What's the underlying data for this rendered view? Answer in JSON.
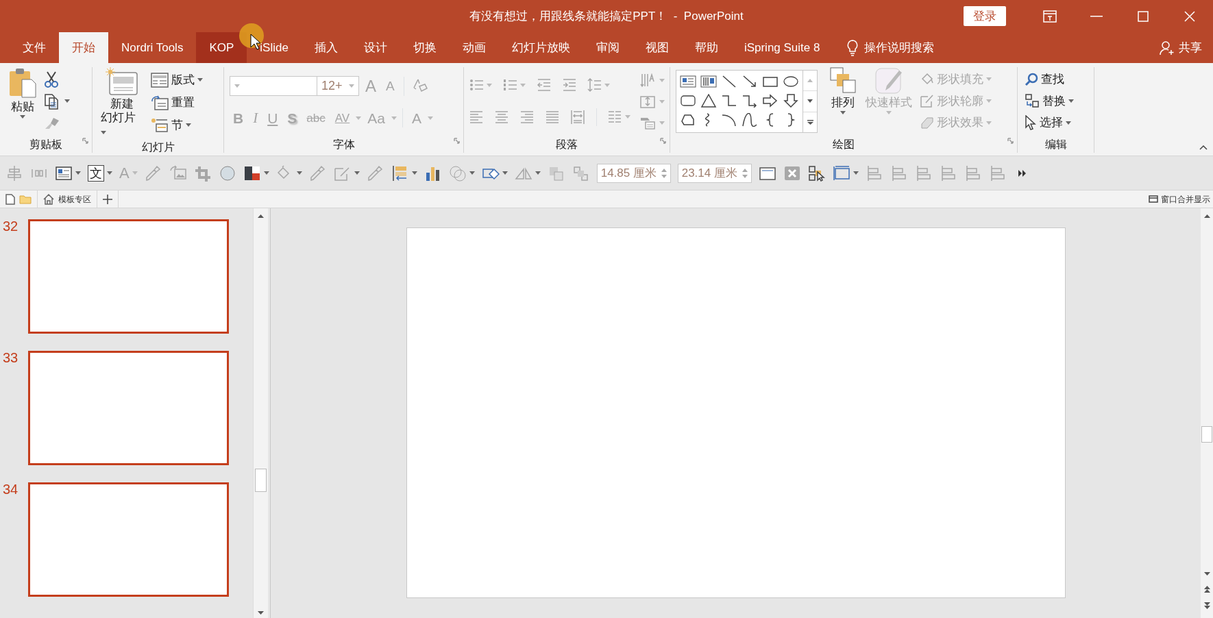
{
  "window": {
    "title": "有没有想过，用跟线条就能搞定PPT！  -  PowerPoint",
    "login_button": "登录"
  },
  "tabs": [
    {
      "label": "文件",
      "selected": false,
      "hovered": false
    },
    {
      "label": "开始",
      "selected": true,
      "hovered": false
    },
    {
      "label": "Nordri Tools",
      "selected": false,
      "hovered": false
    },
    {
      "label": "KOP",
      "selected": false,
      "hovered": true
    },
    {
      "label": "iSlide",
      "selected": false,
      "hovered": false
    },
    {
      "label": "插入",
      "selected": false,
      "hovered": false
    },
    {
      "label": "设计",
      "selected": false,
      "hovered": false
    },
    {
      "label": "切换",
      "selected": false,
      "hovered": false
    },
    {
      "label": "动画",
      "selected": false,
      "hovered": false
    },
    {
      "label": "幻灯片放映",
      "selected": false,
      "hovered": false
    },
    {
      "label": "审阅",
      "selected": false,
      "hovered": false
    },
    {
      "label": "视图",
      "selected": false,
      "hovered": false
    },
    {
      "label": "帮助",
      "selected": false,
      "hovered": false
    },
    {
      "label": "iSpring Suite 8",
      "selected": false,
      "hovered": false
    }
  ],
  "tell_me": "操作说明搜索",
  "share": "共享",
  "ribbon": {
    "groups": [
      {
        "label": "剪贴板",
        "launcher": true,
        "items": [
          {
            "label": "粘贴",
            "disabled": false
          },
          {
            "disabled": false
          },
          {
            "disabled": false
          },
          {
            "disabled": true
          }
        ]
      },
      {
        "label": "幻灯片",
        "launcher": false,
        "items": [
          {
            "label": "新建幻灯片",
            "disabled": false
          },
          {
            "label": "版式",
            "disabled": false
          },
          {
            "label": "重置",
            "disabled": false
          },
          {
            "label": "节",
            "disabled": false
          }
        ]
      },
      {
        "label": "字体",
        "launcher": true,
        "size_value": "12+",
        "items": [
          {
            "kind": "grow",
            "glyph": "A",
            "disabled": true
          },
          {
            "kind": "shrink",
            "glyph": "A",
            "disabled": true
          },
          {
            "kind": "bold",
            "glyph": "B",
            "disabled": true
          },
          {
            "kind": "italic",
            "glyph": "I",
            "disabled": true
          },
          {
            "kind": "underline",
            "glyph": "U",
            "disabled": true
          },
          {
            "kind": "shadow",
            "glyph": "S",
            "disabled": true
          },
          {
            "kind": "strike",
            "glyph": "abc",
            "disabled": true
          },
          {
            "kind": "spacing",
            "glyph": "AV",
            "disabled": true
          },
          {
            "kind": "case",
            "glyph": "Aa",
            "disabled": true
          },
          {
            "kind": "color",
            "glyph": "A",
            "disabled": true
          }
        ]
      },
      {
        "label": "段落",
        "launcher": true
      },
      {
        "label": "绘图",
        "launcher": true,
        "items": [
          {
            "label": "排列",
            "disabled": false
          },
          {
            "label": "快速样式",
            "disabled": true
          },
          {
            "label": "形状填充",
            "disabled": true
          },
          {
            "label": "形状轮廓",
            "disabled": true
          },
          {
            "label": "形状效果",
            "disabled": true
          }
        ]
      },
      {
        "label": "编辑",
        "launcher": false,
        "items": [
          {
            "label": "查找",
            "disabled": false
          },
          {
            "label": "替换",
            "disabled": false
          },
          {
            "label": "选择",
            "disabled": false
          }
        ]
      }
    ]
  },
  "toolbar": {
    "glyphs": [
      "文",
      "A"
    ],
    "fields": [
      {
        "value": "14.85 厘米"
      },
      {
        "value": "23.14 厘米"
      }
    ]
  },
  "doc_tabs": {
    "template_tab": "模板专区",
    "merge_label": "窗口合并显示"
  },
  "slides": [
    {
      "number": "32",
      "selected": true
    },
    {
      "number": "33",
      "selected": true
    },
    {
      "number": "34",
      "selected": true
    }
  ]
}
